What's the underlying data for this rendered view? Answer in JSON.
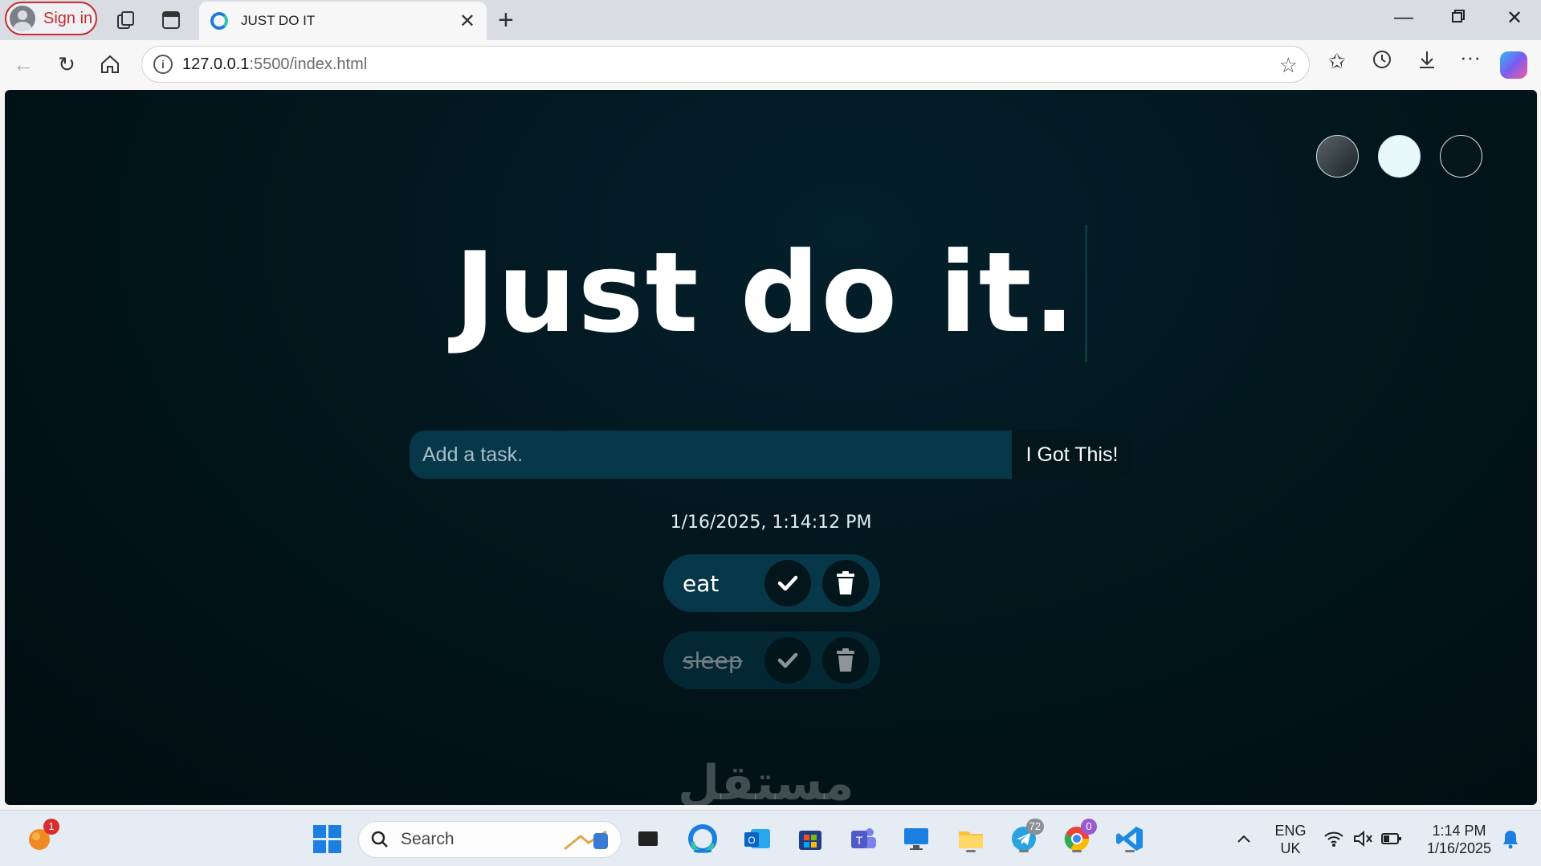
{
  "browser": {
    "signin_label": "Sign in",
    "tab_title": "JUST DO IT",
    "url_host": "127.0.0.1",
    "url_path": ":5500/index.html"
  },
  "page": {
    "heading": "Just do it.",
    "input_placeholder": "Add a task.",
    "submit_label": "I Got This!",
    "datetime": "1/16/2025, 1:14:12 PM",
    "theme_buttons": [
      "standard",
      "light",
      "darker"
    ],
    "tasks": [
      {
        "text": "eat",
        "completed": false
      },
      {
        "text": "sleep",
        "completed": true
      }
    ],
    "watermark": "مستقل"
  },
  "taskbar": {
    "notification_count": "1",
    "search_label": "Search",
    "telegram_badge": "72",
    "chrome_badge": "0",
    "language_line1": "ENG",
    "language_line2": "UK",
    "time": "1:14 PM",
    "date": "1/16/2025"
  },
  "colors": {
    "page_background": "#02141a",
    "task_background": "#07384a",
    "button_dark": "#03161c",
    "accent": "#1a7fe0"
  }
}
